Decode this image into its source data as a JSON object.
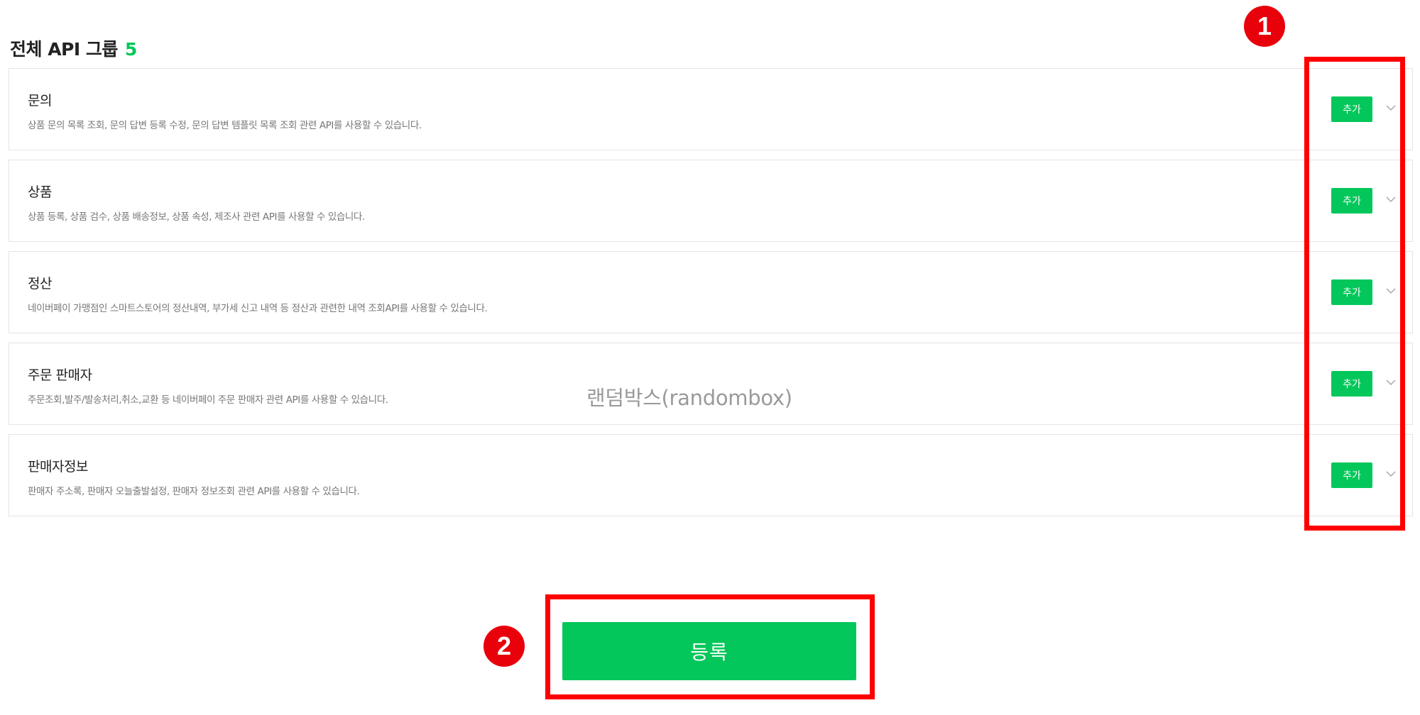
{
  "header": {
    "title": "전체 API 그룹",
    "count": "5"
  },
  "groups": [
    {
      "title": "문의",
      "description": "상품 문의 목록 조회, 문의 답변 등록 수정, 문의 답변 템플릿 목록 조회 관련 API를 사용할 수 있습니다.",
      "add_label": "추가"
    },
    {
      "title": "상품",
      "description": "상품 등록, 상품 검수, 상품 배송정보, 상품 속성, 제조사 관련 API를 사용할 수 있습니다.",
      "add_label": "추가"
    },
    {
      "title": "정산",
      "description": "네이버페이 가맹점인 스마트스토어의 정산내역, 부가세 신고 내역 등 정산과 관련한 내역 조회API를 사용할 수 있습니다.",
      "add_label": "추가"
    },
    {
      "title": "주문 판매자",
      "description": "주문조회,발주/발송처리,취소,교환 등 네이버페이 주문 판매자 관련 API를 사용할 수 있습니다.",
      "add_label": "추가"
    },
    {
      "title": "판매자정보",
      "description": "판매자 주소록, 판매자 오늘출발설정, 판매자 정보조회 관련 API를 사용할 수 있습니다.",
      "add_label": "추가"
    }
  ],
  "icons": {
    "expand": "chevron-down-icon"
  },
  "watermark": "랜덤박스(randombox)",
  "annotations": {
    "marker_1": "1",
    "marker_2": "2",
    "highlight_color": "#ff0000",
    "marker_color": "#e8000b"
  },
  "submit": {
    "label": "등록"
  },
  "colors": {
    "accent": "#03c75a",
    "text": "#222222",
    "muted": "#777777",
    "border": "#e4e4e4"
  }
}
